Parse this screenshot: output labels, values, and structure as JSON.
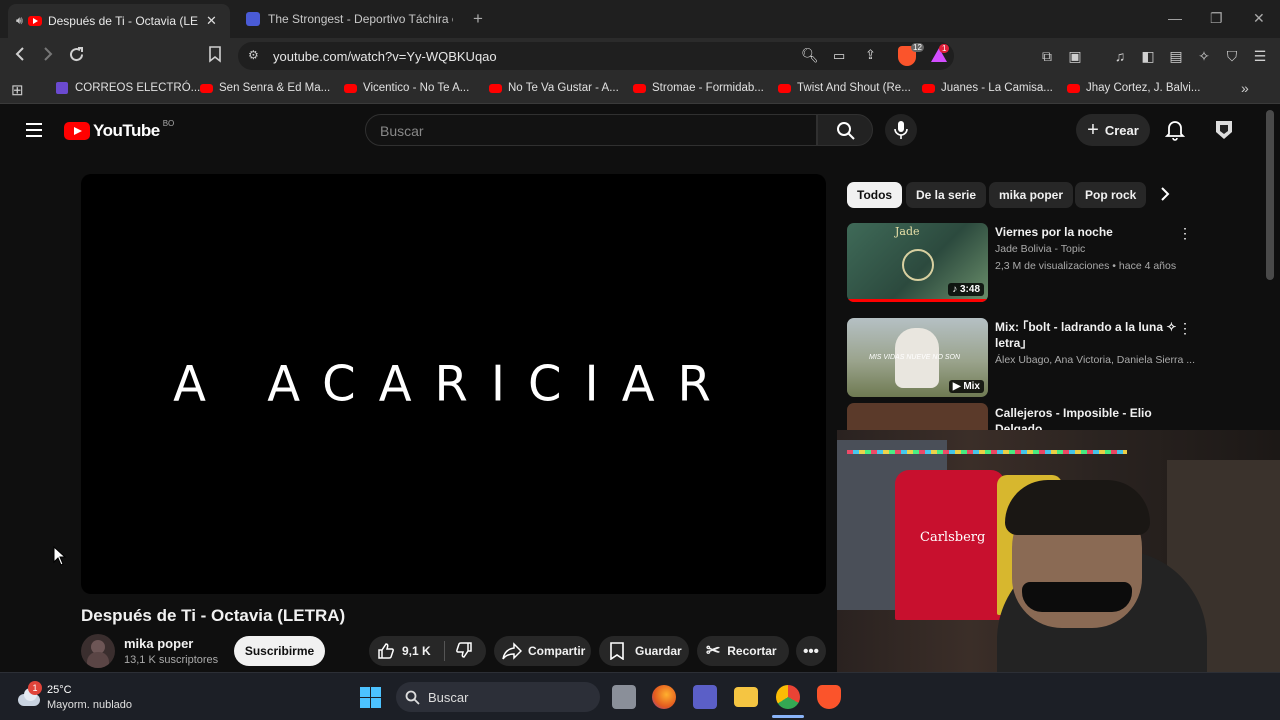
{
  "browser": {
    "tabs": [
      {
        "title": "Después de Ti - Octavia (LETR",
        "active": true
      },
      {
        "title": "The Strongest - Deportivo Táchira en",
        "active": false
      }
    ],
    "new_tab": "+",
    "url": "youtube.com/watch?v=Yy-WQBKUqao",
    "extension_badges": {
      "brave_count": "12",
      "alert_count": "1"
    },
    "bookmarks": [
      "CORREOS ELECTRÓ...",
      "Sen Senra & Ed Ma...",
      "Vicentico - No Te A...",
      "No Te Va Gustar - A...",
      "Stromae - Formidab...",
      "Twist And Shout (Re...",
      "Juanes - La Camisa...",
      "Jhay Cortez, J. Balvi..."
    ]
  },
  "youtube": {
    "logo_text": "YouTube",
    "country_code": "BO",
    "search_placeholder": "Buscar",
    "create_label": "Crear",
    "video": {
      "overlay_text": "A ACARICIAR",
      "title": "Después de Ti - Octavia (LETRA)",
      "channel": "mika poper",
      "subscribers": "13,1 K suscriptores",
      "subscribe_label": "Suscribirme",
      "likes": "9,1 K",
      "share_label": "Compartir",
      "save_label": "Guardar",
      "clip_label": "Recortar"
    },
    "chips": [
      "Todos",
      "De la serie",
      "mika poper",
      "Pop rock"
    ],
    "recommendations": [
      {
        "title": "Viernes por la noche",
        "channel": "Jade Bolivia - Topic",
        "meta": "2,3 M de visualizaciones • hace 4 años",
        "duration": "3:48",
        "thumb_text": "Jade"
      },
      {
        "title": "Mix: ｢bolt - ladrando a la luna ✧ letra｣",
        "channel": "Álex Ubago, Ana Victoria, Daniela Sierra ...",
        "meta": "",
        "duration": "Mix",
        "thumb_text": "MIS VIDAS NUEVE NO SON"
      },
      {
        "title": "Callejeros - Imposible - Elio Delgado",
        "channel": "",
        "meta": "",
        "duration": "",
        "thumb_text": ""
      }
    ]
  },
  "taskbar": {
    "notification_count": "1",
    "temperature": "25°C",
    "weather": "Mayorm. nublado",
    "search_label": "Buscar"
  },
  "colors": {
    "youtube_red": "#ff0000",
    "background": "#0f0f0f",
    "chip_bg": "#272727"
  }
}
